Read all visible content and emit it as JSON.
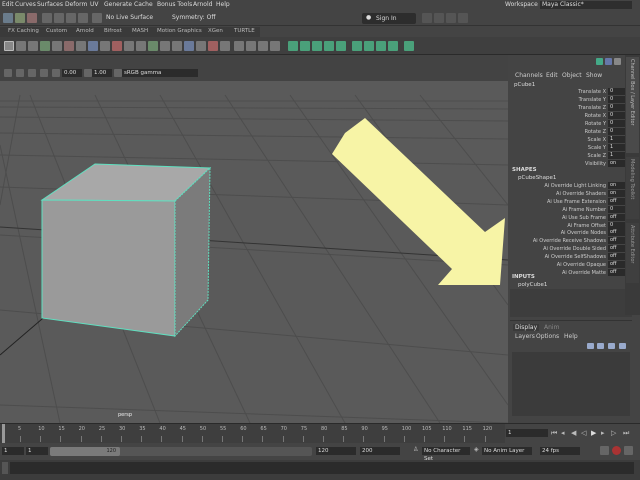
{
  "menu": {
    "items": [
      "Edit",
      "Curves",
      "Surfaces",
      "Deform",
      "UV",
      "Generate",
      "Cache",
      "Bonus Tools",
      "Arnold",
      "Help"
    ],
    "workspace_label": "Workspace :",
    "workspace_value": "Maya Classic*"
  },
  "status": {
    "live_surface": "No Live Surface",
    "symmetry": "Symmetry: Off",
    "sign_in": "Sign In"
  },
  "shelf_tabs": [
    "FX Caching",
    "Custom",
    "Arnold",
    "Bifrost",
    "MASH",
    "Motion Graphics",
    "XGen",
    "TURTLE"
  ],
  "viewport": {
    "exposure": "0.00",
    "gamma": "1.00",
    "color_space": "sRGB gamma",
    "camera_label": "persp"
  },
  "channel_box": {
    "menus": [
      "Channels",
      "Edit",
      "Object",
      "Show"
    ],
    "object_name": "pCube1",
    "attributes": [
      {
        "label": "Translate X",
        "value": "0"
      },
      {
        "label": "Translate Y",
        "value": "0"
      },
      {
        "label": "Translate Z",
        "value": "0"
      },
      {
        "label": "Rotate X",
        "value": "0"
      },
      {
        "label": "Rotate Y",
        "value": "0"
      },
      {
        "label": "Rotate Z",
        "value": "0"
      },
      {
        "label": "Scale X",
        "value": "1"
      },
      {
        "label": "Scale Y",
        "value": "1"
      },
      {
        "label": "Scale Z",
        "value": "1"
      },
      {
        "label": "Visibility",
        "value": "on"
      }
    ],
    "shapes_header": "SHAPES",
    "shape_name": "pCubeShape1",
    "shape_attributes": [
      {
        "label": "Ai Override Light Linking",
        "value": "on"
      },
      {
        "label": "Ai Override Shaders",
        "value": "on"
      },
      {
        "label": "Ai Use Frame Extension",
        "value": "off"
      },
      {
        "label": "Ai Frame Number",
        "value": "0"
      },
      {
        "label": "Ai Use Sub Frame",
        "value": "off"
      },
      {
        "label": "Ai Frame Offset",
        "value": "0"
      },
      {
        "label": "Ai Override Nodes",
        "value": "off"
      },
      {
        "label": "Ai Override Receive Shadows",
        "value": "off"
      },
      {
        "label": "Ai Override Double Sided",
        "value": "off"
      },
      {
        "label": "Ai Override SelfShadows",
        "value": "off"
      },
      {
        "label": "Ai Override Opaque",
        "value": "off"
      },
      {
        "label": "Ai Override Matte",
        "value": "off"
      }
    ],
    "inputs_header": "INPUTS",
    "input_name": "polyCube1"
  },
  "layer_editor": {
    "tabs": [
      "Display",
      "Anim"
    ],
    "menus": [
      "Layers",
      "Options",
      "Help"
    ]
  },
  "side_tabs": [
    "Channel Box / Layer Editor",
    "Modeling Toolkit",
    "Attribute Editor"
  ],
  "timeline": {
    "ticks": [
      "5",
      "10",
      "15",
      "20",
      "25",
      "30",
      "35",
      "40",
      "45",
      "50",
      "55",
      "60",
      "65",
      "70",
      "75",
      "80",
      "85",
      "90",
      "95",
      "100",
      "105",
      "110",
      "115",
      "120"
    ],
    "current_frame": "1"
  },
  "range": {
    "start": "1",
    "range_start": "1",
    "range_end": "120",
    "end": "120",
    "anim_end": "200",
    "character_set": "No Character Set",
    "anim_layer": "No Anim Layer",
    "fps": "24 fps"
  },
  "colors": {
    "arrow": "#f7f4a6",
    "selection_wire": "#5fe0c0",
    "cube_face": "#9a9a9a"
  }
}
